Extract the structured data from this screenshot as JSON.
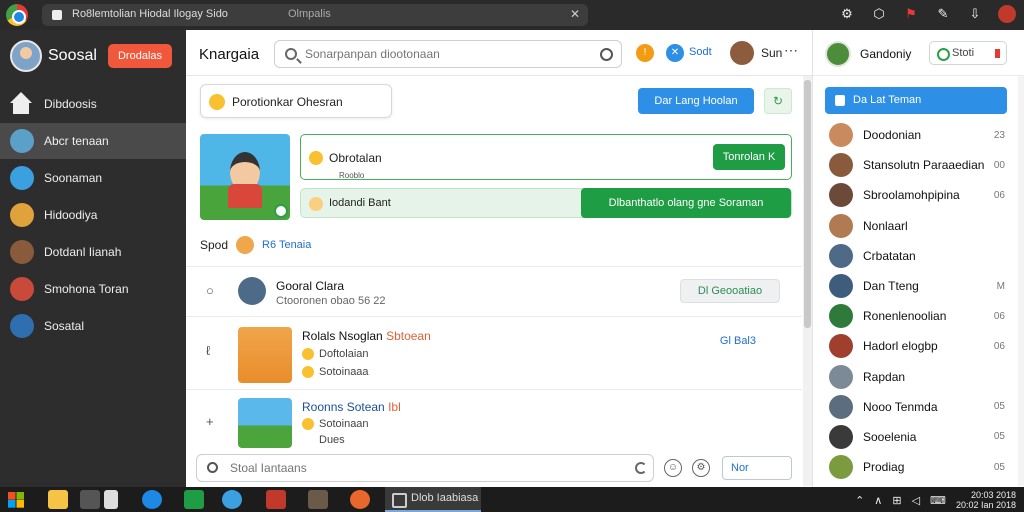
{
  "browser": {
    "tab_title": "Ro8lemtolian Hiodal Ilogay Sido",
    "tab_subtitle": "Olmpalis",
    "close_glyph": "✕",
    "toolbar_icons": [
      "settings-icon",
      "shield-icon",
      "flag-icon",
      "edit-icon",
      "download-icon",
      "profile-icon"
    ]
  },
  "sidebar": {
    "brand_name": "Soosal",
    "brand_button": "Drodalas",
    "items": [
      {
        "label": "Dibdoosis",
        "icon": "home-icon",
        "active": false
      },
      {
        "label": "Abcr tenaan",
        "icon": "avatar-icon",
        "active": true
      },
      {
        "label": "Soonaman",
        "icon": "avatar-icon",
        "active": false
      },
      {
        "label": "Hidoodiya",
        "icon": "avatar-icon",
        "active": false
      },
      {
        "label": "Dotdanl Iianah",
        "icon": "avatar-icon",
        "active": false
      },
      {
        "label": "Smohona Toran",
        "icon": "avatar-icon",
        "active": false
      },
      {
        "label": "Sosatal",
        "icon": "avatar-icon",
        "active": false
      }
    ]
  },
  "main": {
    "title": "Knargaia",
    "search_placeholder": "Sonarpanpan diootonaan",
    "header_user_label": "Sun",
    "header_action_label": "Sodt",
    "more_glyph": "⋯",
    "compose_label": "Porotionkar Ohesran",
    "primary_button": "Dar Lang Hoolan",
    "feature": {
      "status_text": "Obrotalan",
      "tiny_label": "Rooblo",
      "status_button": "Tonrolan K",
      "note_text": "Iodandi Bant",
      "action_button": "Dlbanthatlo olang gne Soraman"
    },
    "suggest": {
      "label": "Spod",
      "link": "R6 Tenaia"
    },
    "posts": [
      {
        "lead": "○",
        "title": "Gooral Clara",
        "sub": "Ctooronen obao 56 22",
        "button": "Dl Geooatiao"
      },
      {
        "lead": "ℓ",
        "title": "Rolals Nsoglan",
        "title_extra": "Sbtoean",
        "line1": "Doftolaian",
        "line2": "Sotoinaaa",
        "tag": "Gl Bal3"
      },
      {
        "lead": "+",
        "title": "Roonns Sotean",
        "title_extra": "Ibl",
        "line1": "Sotoinaan",
        "line2": "Dues"
      }
    ],
    "chat_placeholder": "Stoal Iantaans",
    "send_label": "Nor"
  },
  "rside": {
    "user_name": "Gandoniy",
    "search_button": "Stoti",
    "add_button": "Da Lat Teman",
    "friends": [
      {
        "name": "Doodonian",
        "meta": "23",
        "color": "#c98b5e"
      },
      {
        "name": "Stansolutn Paraaedian",
        "meta": "00",
        "color": "#8a5a3c"
      },
      {
        "name": "Sbroolamohpipina",
        "meta": "06",
        "color": "#6b4a3a"
      },
      {
        "name": "Nonlaarl",
        "meta": "",
        "color": "#b07a52"
      },
      {
        "name": "Crbatatan",
        "meta": "",
        "color": "#4e6a86"
      },
      {
        "name": "Dan Tteng",
        "meta": "M",
        "color": "#3e5d7c"
      },
      {
        "name": "Ronenlenoolian",
        "meta": "06",
        "color": "#2f7a3a"
      },
      {
        "name": "Hadorl elogbp",
        "meta": "06",
        "color": "#a03f2e"
      },
      {
        "name": "Rapdan",
        "meta": "",
        "color": "#7c8a97"
      },
      {
        "name": "Nooo Tenmda",
        "meta": "05",
        "color": "#5b6d7e"
      },
      {
        "name": "Sooelenia",
        "meta": "05",
        "color": "#3a3a3a"
      },
      {
        "name": "Prodiag",
        "meta": "05",
        "color": "#7b9b3e"
      }
    ]
  },
  "taskbar": {
    "active_label": "Dlob Iaabiasa",
    "clock_line1": "20:03 2018",
    "clock_line2": "20:02 Ian 2018",
    "apps": [
      "explorer-icon",
      "store-icon",
      "edge-icon",
      "spreadsheet-icon",
      "ie-icon",
      "gallery-icon",
      "terminal-icon",
      "firefox-icon"
    ]
  },
  "colors": {
    "accent_blue": "#2d8fe6",
    "accent_green": "#1f9d45",
    "brand_red": "#f0573b"
  }
}
